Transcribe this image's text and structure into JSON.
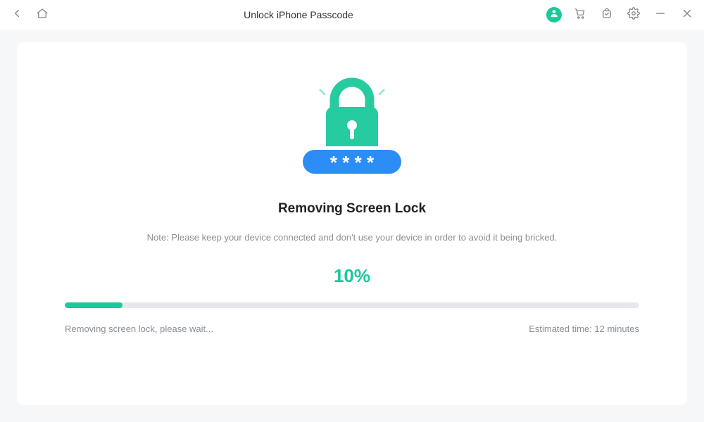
{
  "titlebar": {
    "title": "Unlock iPhone Passcode"
  },
  "main": {
    "heading": "Removing Screen Lock",
    "note": "Note: Please keep your device connected and don't use your device in order to avoid it being bricked.",
    "percent_label": "10%",
    "progress_percent": 10,
    "status_left": "Removing screen lock, please wait...",
    "status_right": "Estimated time: 12 minutes",
    "password_mask": "* * * *"
  },
  "colors": {
    "accent": "#19c99b",
    "pill": "#2d8df6",
    "muted": "#8a8f96"
  },
  "icons": {
    "back": "back-icon",
    "home": "home-icon",
    "account": "account-icon",
    "cart": "cart-icon",
    "bag": "bag-icon",
    "settings": "gear-icon",
    "minimize": "minimize-icon",
    "close": "close-icon",
    "lock": "lock-icon"
  }
}
